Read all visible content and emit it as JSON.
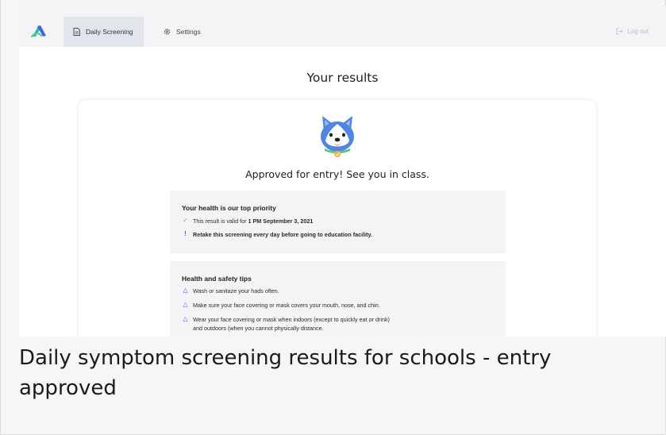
{
  "nav": {
    "logo": "logo-icon",
    "tabs": [
      {
        "label": "Daily Screening",
        "icon": "document-icon",
        "active": true
      },
      {
        "label": "Settings",
        "icon": "gear-icon",
        "active": false
      }
    ],
    "logout_label": "Log out",
    "logout_icon": "logout-icon"
  },
  "page": {
    "title": "Your results",
    "mascot_icon": "husky-dog-icon",
    "status_text": "Approved for entry! See you in class."
  },
  "health": {
    "heading": "Your health is our top priority",
    "valid_prefix": "This result is valid for ",
    "valid_time": "1 PM September 3, 2021",
    "retake": "Retake this screening every day before going to education facility."
  },
  "tips": {
    "heading": "Health and safety tips",
    "items": [
      "Wash or sanitaze your hads often.",
      "Make sure your face covering or mask covers your mouth, nose, and chin.",
      "Wear your face covering or mask when indoors (except to quickly eat or drink)",
      "and outdoors (when you cannot physically distance."
    ]
  },
  "caption": "Daily symptom screening results for schools - entry approved",
  "colors": {
    "accent_blue": "#3d63f0",
    "check_green": "#52b87a",
    "active_tab_bg": "#e3e5ed",
    "panel_bg": "#f4f4f6"
  }
}
